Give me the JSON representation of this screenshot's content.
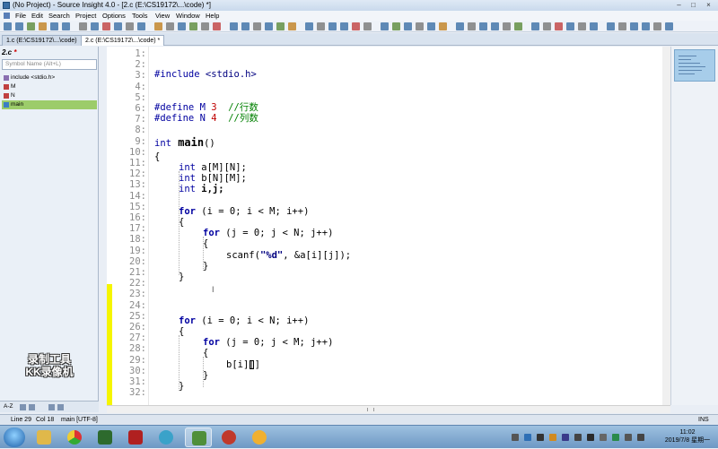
{
  "window": {
    "title": "(No Project) - Source Insight 4.0 - [2.c (E:\\CS19172\\...\\code) *]",
    "minimize": "–",
    "maximize": "□",
    "close": "×"
  },
  "menu": [
    "File",
    "Edit",
    "Search",
    "Project",
    "Options",
    "Tools",
    "View",
    "Window",
    "Help"
  ],
  "tabs": [
    {
      "label": "1.c (E:\\CS19172\\...\\code)"
    },
    {
      "label": "2.c (E:\\CS19172\\...\\code) *"
    }
  ],
  "symbol_panel": {
    "file": "2.c",
    "modified_mark": "*",
    "search_placeholder": "Symbol Name (Alt+L)",
    "symbols": [
      {
        "label": "include <stdio.h>",
        "icon_color": "#8a6fb0"
      },
      {
        "label": "M",
        "icon_color": "#c04040"
      },
      {
        "label": "N",
        "icon_color": "#c04040"
      },
      {
        "label": "main",
        "icon_color": "#3b7dc4",
        "selected": true
      }
    ],
    "bottom_label": "A-Z",
    "watermark_line1": "录制工具",
    "watermark_line2": "KK录像机"
  },
  "editor": {
    "line_numbers": [
      "1:",
      "2:",
      "3:",
      "4:",
      "5:",
      "6:",
      "7:",
      "8:",
      "9:",
      "10:",
      "11:",
      "12:",
      "13:",
      "14:",
      "15:",
      "16:",
      "17:",
      "18:",
      "19:",
      "20:",
      "21:",
      "22:",
      "23:",
      "24:",
      "25:",
      "26:",
      "27:",
      "28:",
      "29:",
      "30:",
      "31:",
      "32:"
    ],
    "lines": {
      "l3_pp": "#include",
      "l3_rest": " <stdio.h>",
      "l6_pp": "#define",
      "l6_name": " M ",
      "l6_num": "3",
      "l6_cm": "  //行数",
      "l7_pp": "#define",
      "l7_name": " N ",
      "l7_num": "4",
      "l7_cm": "  //列数",
      "l9_kw": "int",
      "l9_fn": " main",
      "l9_rest": "()",
      "l10": "{",
      "l12_kw": "int",
      "l12_rest": " a[M][N];",
      "l13_kw": "int",
      "l13_rest": " b[N][M];",
      "l14_kw": "int",
      "l14_rest": " i,j;",
      "l16_kw": "for",
      "l16_rest": " (i = 0; i < M; i++)",
      "l17": "{",
      "l18_kw": "for",
      "l18_rest": " (j = 0; j < N; j++)",
      "l19": "{",
      "l20_a": "scanf(",
      "l20_str": "\"%d\"",
      "l20_b": ", &a[i][j]);",
      "l21": "}",
      "l22": "}",
      "l25_kw": "for",
      "l25_rest": " (i = 0; i < N; i++)",
      "l26": "{",
      "l27_kw": "for",
      "l27_rest": " (j = 0; j < M; j++)",
      "l28": "{",
      "l29": "b[i][]",
      "l30": "}",
      "l31": "}"
    },
    "cursor_glyph": "I"
  },
  "status": {
    "line": "Line 29",
    "col": "Col 18",
    "context": "main [UTF-8]",
    "mode": "INS"
  },
  "taskbar": {
    "clock_time": "11:02",
    "clock_date": "2019/7/8 星期一"
  }
}
